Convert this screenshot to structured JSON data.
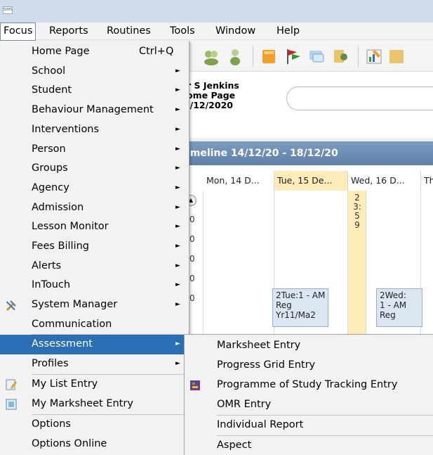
{
  "titlebar": {
    "logo": "SIMS"
  },
  "menubar": {
    "items": [
      {
        "label": "Focus"
      },
      {
        "label": "Reports"
      },
      {
        "label": "Routines"
      },
      {
        "label": "Tools"
      },
      {
        "label": "Window"
      },
      {
        "label": "Help"
      }
    ]
  },
  "userinfo": {
    "line1": "r S Jenkins",
    "line2": "ome Page",
    "line3": "I/12/2020"
  },
  "timeline": {
    "title": "imeline 14/12/20 - 18/12/20",
    "columns": [
      "Mon, 14 D...",
      "Tue, 15 De...",
      "Wed, 16 D...",
      "Th"
    ],
    "hour_numbers": [
      "0",
      "0",
      "0",
      "0",
      "0"
    ],
    "vertical_number": "2\n3:\n5\n9",
    "events": [
      {
        "text": "2Tue:1 - AM\nReg\nYr11/Ma2"
      },
      {
        "text": "2Wed:\n1 - AM\nReg"
      }
    ]
  },
  "focus_menu": {
    "items": [
      {
        "label": "Home Page",
        "shortcut": "Ctrl+Q"
      },
      {
        "label": "School",
        "arrow": "►"
      },
      {
        "label": "Student",
        "arrow": "►"
      },
      {
        "label": "Behaviour Management",
        "arrow": "►"
      },
      {
        "label": "Interventions",
        "arrow": "►"
      },
      {
        "label": "Person",
        "arrow": "►"
      },
      {
        "label": "Groups",
        "arrow": "►"
      },
      {
        "label": "Agency",
        "arrow": "►"
      },
      {
        "label": "Admission",
        "arrow": "►"
      },
      {
        "label": "Lesson Monitor",
        "arrow": "►"
      },
      {
        "label": "Fees Billing",
        "arrow": "►"
      },
      {
        "label": "Alerts",
        "arrow": "►"
      },
      {
        "label": "InTouch",
        "arrow": "►"
      },
      {
        "label": "System Manager",
        "arrow": "►"
      },
      {
        "label": "Communication"
      },
      {
        "label": "Assessment",
        "arrow": "►"
      },
      {
        "label": "Profiles",
        "arrow": "►"
      },
      {
        "label": "My List Entry"
      },
      {
        "label": "My Marksheet Entry"
      },
      {
        "label": "Options"
      },
      {
        "label": "Options Online"
      }
    ]
  },
  "assessment_submenu": {
    "items": [
      {
        "label": "Marksheet Entry"
      },
      {
        "label": "Progress Grid Entry"
      },
      {
        "label": "Programme of Study Tracking Entry"
      },
      {
        "label": "OMR Entry"
      },
      {
        "label": "Individual Report"
      },
      {
        "label": "Aspect"
      }
    ]
  },
  "colors": {
    "highlight": "#2a6fb6",
    "timeline_header": "#6a8ab2",
    "today_column": "#fdebb8"
  }
}
